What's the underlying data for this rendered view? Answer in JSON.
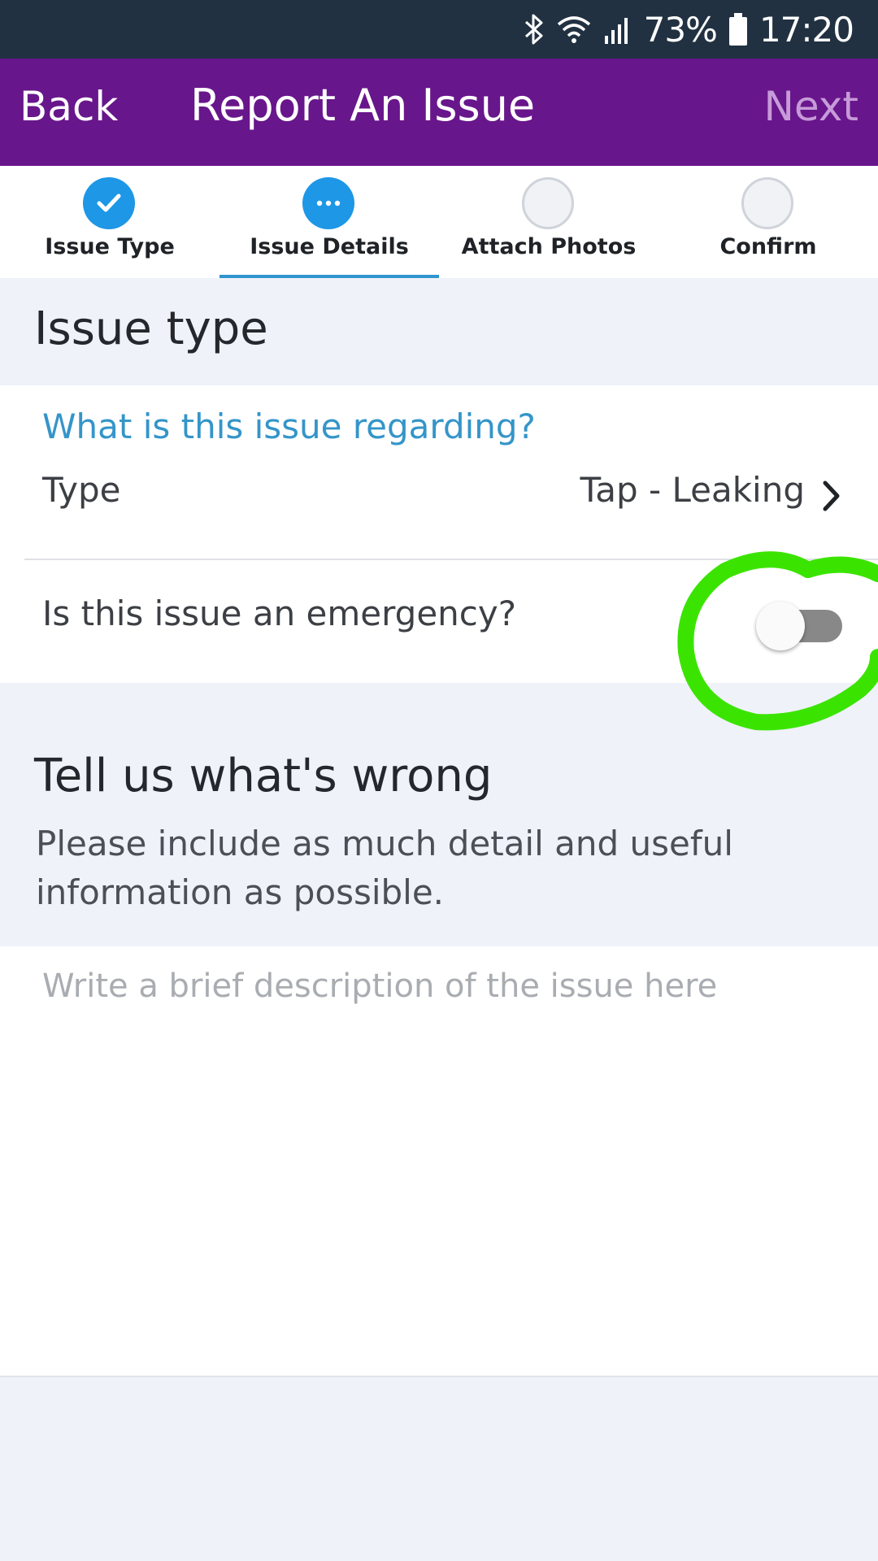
{
  "status_bar": {
    "battery_percent": "73%",
    "time": "17:20",
    "icons": [
      "bluetooth-icon",
      "wifi-icon",
      "signal-icon",
      "battery-icon"
    ]
  },
  "header": {
    "back_label": "Back",
    "title": "Report An Issue",
    "next_label": "Next"
  },
  "steps": [
    {
      "label": "Issue Type",
      "state": "done"
    },
    {
      "label": "Issue Details",
      "state": "active"
    },
    {
      "label": "Attach Photos",
      "state": "pending"
    },
    {
      "label": "Confirm",
      "state": "pending"
    }
  ],
  "issue_type_section": {
    "title": "Issue type",
    "question": "What is this issue regarding?",
    "type_label": "Type",
    "type_value": "Tap - Leaking",
    "emergency_label": "Is this issue an emergency?",
    "emergency_on": false
  },
  "details_section": {
    "title": "Tell us what's wrong",
    "subtitle": "Please include as much detail and useful information as possible.",
    "description_placeholder": "Write a brief description of the issue here",
    "description_value": ""
  },
  "colors": {
    "header_bg": "#68168b",
    "status_bar_bg": "#213142",
    "step_active": "#1d97e6",
    "question_text": "#3495c9",
    "annotation": "#3be400",
    "page_bg": "#eff2f9"
  }
}
